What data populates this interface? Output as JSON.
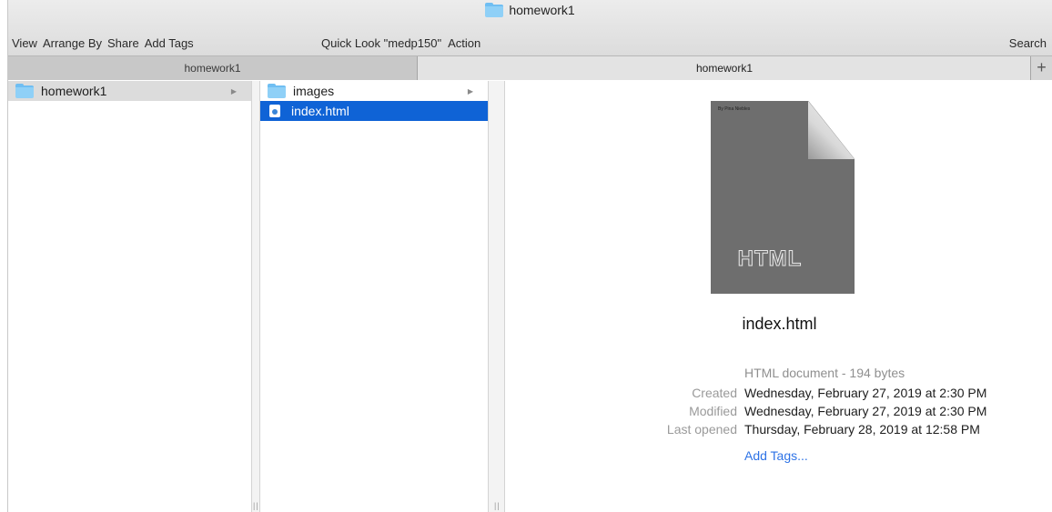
{
  "window": {
    "title": "homework1"
  },
  "toolbar": {
    "view": "View",
    "arrange_by": "Arrange By",
    "share": "Share",
    "add_tags": "Add Tags",
    "quick_look": "Quick Look \"medp150\"",
    "action": "Action",
    "search": "Search"
  },
  "tabs": {
    "items": [
      {
        "label": "homework1"
      },
      {
        "label": "homework1"
      }
    ],
    "add_label": "+"
  },
  "columns": {
    "col1": [
      {
        "label": "homework1",
        "icon": "folder-icon",
        "has_children": true
      }
    ],
    "col2": [
      {
        "label": "images",
        "icon": "folder-icon",
        "has_children": true
      },
      {
        "label": "index.html",
        "icon": "html-file-icon",
        "selected": true
      }
    ],
    "resize_glyph": "||"
  },
  "preview": {
    "thumb_tiny_text": "By Pina Niebles",
    "thumb_label": "HTML",
    "file_name": "index.html",
    "kind": "HTML document - 194 bytes",
    "meta": [
      {
        "key": "Created",
        "value": "Wednesday, February 27, 2019 at 2:30 PM"
      },
      {
        "key": "Modified",
        "value": "Wednesday, February 27, 2019 at 2:30 PM"
      },
      {
        "key": "Last opened",
        "value": "Thursday, February 28, 2019 at 12:58 PM"
      }
    ],
    "add_tags": "Add Tags..."
  },
  "colors": {
    "selection_blue": "#0f63d6",
    "link_blue": "#2e73e6",
    "folder_blue": "#8fd0f7"
  }
}
